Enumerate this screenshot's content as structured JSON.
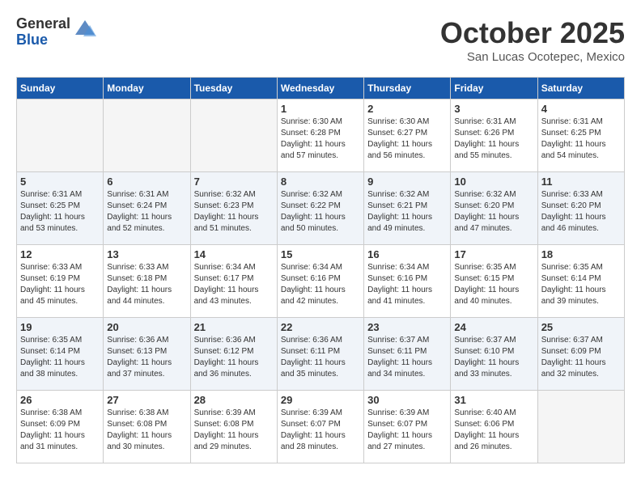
{
  "header": {
    "logo_general": "General",
    "logo_blue": "Blue",
    "month_title": "October 2025",
    "subtitle": "San Lucas Ocotepec, Mexico"
  },
  "weekdays": [
    "Sunday",
    "Monday",
    "Tuesday",
    "Wednesday",
    "Thursday",
    "Friday",
    "Saturday"
  ],
  "weeks": [
    [
      {
        "day": "",
        "info": ""
      },
      {
        "day": "",
        "info": ""
      },
      {
        "day": "",
        "info": ""
      },
      {
        "day": "1",
        "info": "Sunrise: 6:30 AM\nSunset: 6:28 PM\nDaylight: 11 hours\nand 57 minutes."
      },
      {
        "day": "2",
        "info": "Sunrise: 6:30 AM\nSunset: 6:27 PM\nDaylight: 11 hours\nand 56 minutes."
      },
      {
        "day": "3",
        "info": "Sunrise: 6:31 AM\nSunset: 6:26 PM\nDaylight: 11 hours\nand 55 minutes."
      },
      {
        "day": "4",
        "info": "Sunrise: 6:31 AM\nSunset: 6:25 PM\nDaylight: 11 hours\nand 54 minutes."
      }
    ],
    [
      {
        "day": "5",
        "info": "Sunrise: 6:31 AM\nSunset: 6:25 PM\nDaylight: 11 hours\nand 53 minutes."
      },
      {
        "day": "6",
        "info": "Sunrise: 6:31 AM\nSunset: 6:24 PM\nDaylight: 11 hours\nand 52 minutes."
      },
      {
        "day": "7",
        "info": "Sunrise: 6:32 AM\nSunset: 6:23 PM\nDaylight: 11 hours\nand 51 minutes."
      },
      {
        "day": "8",
        "info": "Sunrise: 6:32 AM\nSunset: 6:22 PM\nDaylight: 11 hours\nand 50 minutes."
      },
      {
        "day": "9",
        "info": "Sunrise: 6:32 AM\nSunset: 6:21 PM\nDaylight: 11 hours\nand 49 minutes."
      },
      {
        "day": "10",
        "info": "Sunrise: 6:32 AM\nSunset: 6:20 PM\nDaylight: 11 hours\nand 47 minutes."
      },
      {
        "day": "11",
        "info": "Sunrise: 6:33 AM\nSunset: 6:20 PM\nDaylight: 11 hours\nand 46 minutes."
      }
    ],
    [
      {
        "day": "12",
        "info": "Sunrise: 6:33 AM\nSunset: 6:19 PM\nDaylight: 11 hours\nand 45 minutes."
      },
      {
        "day": "13",
        "info": "Sunrise: 6:33 AM\nSunset: 6:18 PM\nDaylight: 11 hours\nand 44 minutes."
      },
      {
        "day": "14",
        "info": "Sunrise: 6:34 AM\nSunset: 6:17 PM\nDaylight: 11 hours\nand 43 minutes."
      },
      {
        "day": "15",
        "info": "Sunrise: 6:34 AM\nSunset: 6:16 PM\nDaylight: 11 hours\nand 42 minutes."
      },
      {
        "day": "16",
        "info": "Sunrise: 6:34 AM\nSunset: 6:16 PM\nDaylight: 11 hours\nand 41 minutes."
      },
      {
        "day": "17",
        "info": "Sunrise: 6:35 AM\nSunset: 6:15 PM\nDaylight: 11 hours\nand 40 minutes."
      },
      {
        "day": "18",
        "info": "Sunrise: 6:35 AM\nSunset: 6:14 PM\nDaylight: 11 hours\nand 39 minutes."
      }
    ],
    [
      {
        "day": "19",
        "info": "Sunrise: 6:35 AM\nSunset: 6:14 PM\nDaylight: 11 hours\nand 38 minutes."
      },
      {
        "day": "20",
        "info": "Sunrise: 6:36 AM\nSunset: 6:13 PM\nDaylight: 11 hours\nand 37 minutes."
      },
      {
        "day": "21",
        "info": "Sunrise: 6:36 AM\nSunset: 6:12 PM\nDaylight: 11 hours\nand 36 minutes."
      },
      {
        "day": "22",
        "info": "Sunrise: 6:36 AM\nSunset: 6:11 PM\nDaylight: 11 hours\nand 35 minutes."
      },
      {
        "day": "23",
        "info": "Sunrise: 6:37 AM\nSunset: 6:11 PM\nDaylight: 11 hours\nand 34 minutes."
      },
      {
        "day": "24",
        "info": "Sunrise: 6:37 AM\nSunset: 6:10 PM\nDaylight: 11 hours\nand 33 minutes."
      },
      {
        "day": "25",
        "info": "Sunrise: 6:37 AM\nSunset: 6:09 PM\nDaylight: 11 hours\nand 32 minutes."
      }
    ],
    [
      {
        "day": "26",
        "info": "Sunrise: 6:38 AM\nSunset: 6:09 PM\nDaylight: 11 hours\nand 31 minutes."
      },
      {
        "day": "27",
        "info": "Sunrise: 6:38 AM\nSunset: 6:08 PM\nDaylight: 11 hours\nand 30 minutes."
      },
      {
        "day": "28",
        "info": "Sunrise: 6:39 AM\nSunset: 6:08 PM\nDaylight: 11 hours\nand 29 minutes."
      },
      {
        "day": "29",
        "info": "Sunrise: 6:39 AM\nSunset: 6:07 PM\nDaylight: 11 hours\nand 28 minutes."
      },
      {
        "day": "30",
        "info": "Sunrise: 6:39 AM\nSunset: 6:07 PM\nDaylight: 11 hours\nand 27 minutes."
      },
      {
        "day": "31",
        "info": "Sunrise: 6:40 AM\nSunset: 6:06 PM\nDaylight: 11 hours\nand 26 minutes."
      },
      {
        "day": "",
        "info": ""
      }
    ]
  ]
}
